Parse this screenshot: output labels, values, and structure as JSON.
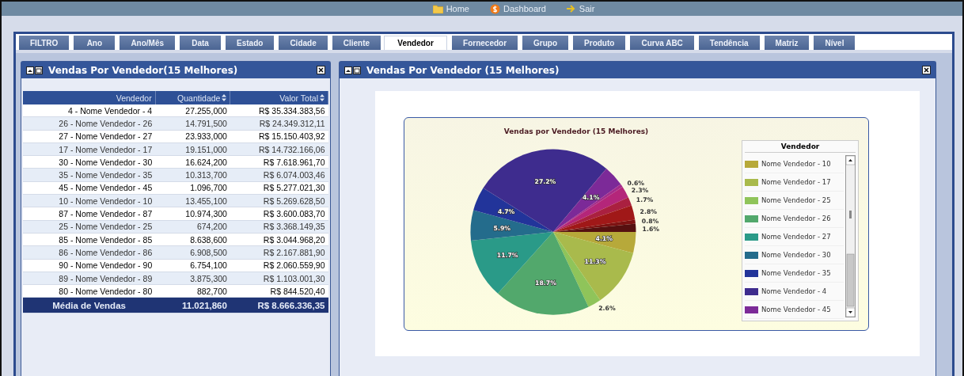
{
  "top_nav": [
    {
      "kind": "folder",
      "label": "Home"
    },
    {
      "kind": "coin",
      "label": "Dashboard"
    },
    {
      "kind": "arrow",
      "label": "Sair"
    }
  ],
  "tabs": [
    {
      "label": "FILTRO",
      "selected": false
    },
    {
      "label": "Ano",
      "selected": false
    },
    {
      "label": "Ano/Mês",
      "selected": false
    },
    {
      "label": "Data",
      "selected": false
    },
    {
      "label": "Estado",
      "selected": false
    },
    {
      "label": "Cidade",
      "selected": false
    },
    {
      "label": "Cliente",
      "selected": false
    },
    {
      "label": "Vendedor",
      "selected": true
    },
    {
      "label": "Fornecedor",
      "selected": false
    },
    {
      "label": "Grupo",
      "selected": false
    },
    {
      "label": "Produto",
      "selected": false
    },
    {
      "label": "Curva ABC",
      "selected": false
    },
    {
      "label": "Tendência",
      "selected": false
    },
    {
      "label": "Matriz",
      "selected": false
    },
    {
      "label": "Nível",
      "selected": false
    }
  ],
  "left_panel": {
    "title": "Vendas Por Vendedor(15 Melhores)",
    "table": {
      "columns": [
        {
          "label": "Vendedor",
          "sortable": false
        },
        {
          "label": "Quantidade",
          "sortable": true
        },
        {
          "label": "Valor Total",
          "sortable": true
        }
      ],
      "rows": [
        [
          "4 - Nome Vendedor - 4",
          "27.255,000",
          "R$ 35.334.383,56"
        ],
        [
          "26 - Nome Vendedor - 26",
          "14.791,500",
          "R$ 24.349.312,11"
        ],
        [
          "27 - Nome Vendedor - 27",
          "23.933,000",
          "R$ 15.150.403,92"
        ],
        [
          "17 - Nome Vendedor - 17",
          "19.151,000",
          "R$ 14.732.166,06"
        ],
        [
          "30 - Nome Vendedor - 30",
          "16.624,200",
          "R$ 7.618.961,70"
        ],
        [
          "35 - Nome Vendedor - 35",
          "10.313,700",
          "R$ 6.074.003,46"
        ],
        [
          "45 - Nome Vendedor - 45",
          "1.096,700",
          "R$ 5.277.021,30"
        ],
        [
          "10 - Nome Vendedor - 10",
          "13.455,100",
          "R$ 5.269.628,50"
        ],
        [
          "87 - Nome Vendedor - 87",
          "10.974,300",
          "R$ 3.600.083,70"
        ],
        [
          "25 - Nome Vendedor - 25",
          "674,200",
          "R$ 3.368.149,35"
        ],
        [
          "85 - Nome Vendedor - 85",
          "8.638,600",
          "R$ 3.044.968,20"
        ],
        [
          "86 - Nome Vendedor - 86",
          "6.908,500",
          "R$ 2.167.881,90"
        ],
        [
          "90 - Nome Vendedor - 90",
          "6.754,100",
          "R$ 2.060.559,90"
        ],
        [
          "89 - Nome Vendedor - 89",
          "3.875,300",
          "R$ 1.103.001,30"
        ],
        [
          "80 - Nome Vendedor - 80",
          "882,700",
          "R$ 844.520,40"
        ]
      ],
      "footer": [
        "Média de Vendas",
        "11.021,860",
        "R$ 8.666.336,35"
      ]
    }
  },
  "right_panel": {
    "title": "Vendas Por Vendedor (15 Melhores)",
    "chart_data": {
      "type": "pie",
      "title": "Vendas por Vendedor (15 Melhores)",
      "value_labels": [
        "4.1%",
        "11.3%",
        "2.6%",
        "18.7%",
        "11.7%",
        "5.9%",
        "4.7%",
        "27.2%",
        "4.1%",
        "0.6%",
        "2.3%",
        "1.7%",
        "2.8%",
        "0.8%",
        "1.6%"
      ],
      "series": [
        {
          "name": "Vendedor",
          "colors": [
            "#b7a93a",
            "#a9ba4c",
            "#8fc45a",
            "#52a86c",
            "#2a9a88",
            "#246c8c",
            "#22349a",
            "#3e2c8e",
            "#7c2a98",
            "#a42c8c",
            "#b4267a",
            "#aa2040",
            "#a01818",
            "#7e1212",
            "#561010"
          ],
          "values": [
            4.1,
            11.3,
            2.6,
            18.7,
            11.7,
            5.9,
            4.7,
            27.2,
            4.1,
            0.6,
            2.3,
            1.7,
            2.8,
            0.8,
            1.6
          ]
        }
      ]
    },
    "legend": {
      "items": [
        {
          "label": "Nome Vendedor - 10",
          "color": "#b7a93a"
        },
        {
          "label": "Nome Vendedor - 17",
          "color": "#a9ba4c"
        },
        {
          "label": "Nome Vendedor - 25",
          "color": "#8fc45a"
        },
        {
          "label": "Nome Vendedor - 26",
          "color": "#52a86c"
        },
        {
          "label": "Nome Vendedor - 27",
          "color": "#2a9a88"
        },
        {
          "label": "Nome Vendedor - 30",
          "color": "#246c8c"
        },
        {
          "label": "Nome Vendedor - 35",
          "color": "#22349a"
        },
        {
          "label": "Nome Vendedor - 4",
          "color": "#3e2c8e"
        },
        {
          "label": "Nome Vendedor - 45",
          "color": "#7c2a98"
        }
      ]
    }
  }
}
